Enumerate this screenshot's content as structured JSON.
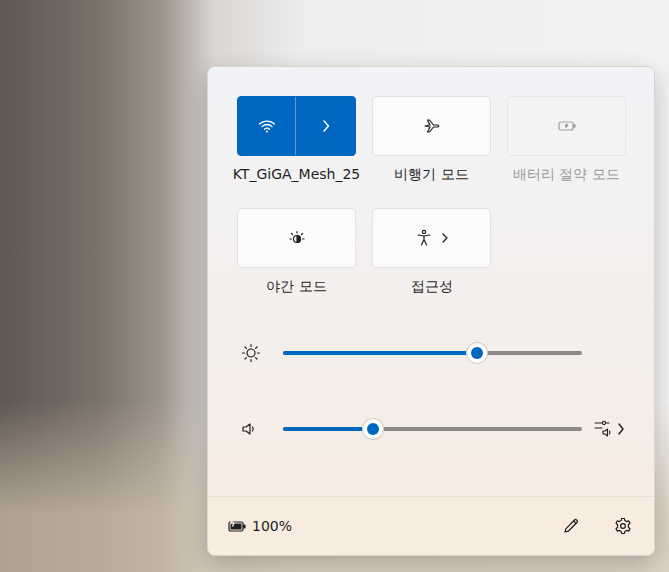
{
  "tiles": [
    {
      "label": "KT_GiGA_Mesh_25",
      "kind": "split",
      "icon": "wifi",
      "on": true,
      "disabled": false
    },
    {
      "label": "비행기 모드",
      "kind": "toggle",
      "icon": "airplane",
      "on": false,
      "disabled": false
    },
    {
      "label": "배터리 절약 모드",
      "kind": "toggle",
      "icon": "battery-saver",
      "on": false,
      "disabled": true
    },
    {
      "label": "야간 모드",
      "kind": "toggle",
      "icon": "night-light",
      "on": false,
      "disabled": false
    },
    {
      "label": "접근성",
      "kind": "expand",
      "icon": "accessibility",
      "on": false,
      "disabled": false
    }
  ],
  "sliders": [
    {
      "name": "brightness",
      "level": 0.65
    },
    {
      "name": "volume",
      "level": 0.3
    }
  ],
  "footer": {
    "battery": "100%"
  }
}
